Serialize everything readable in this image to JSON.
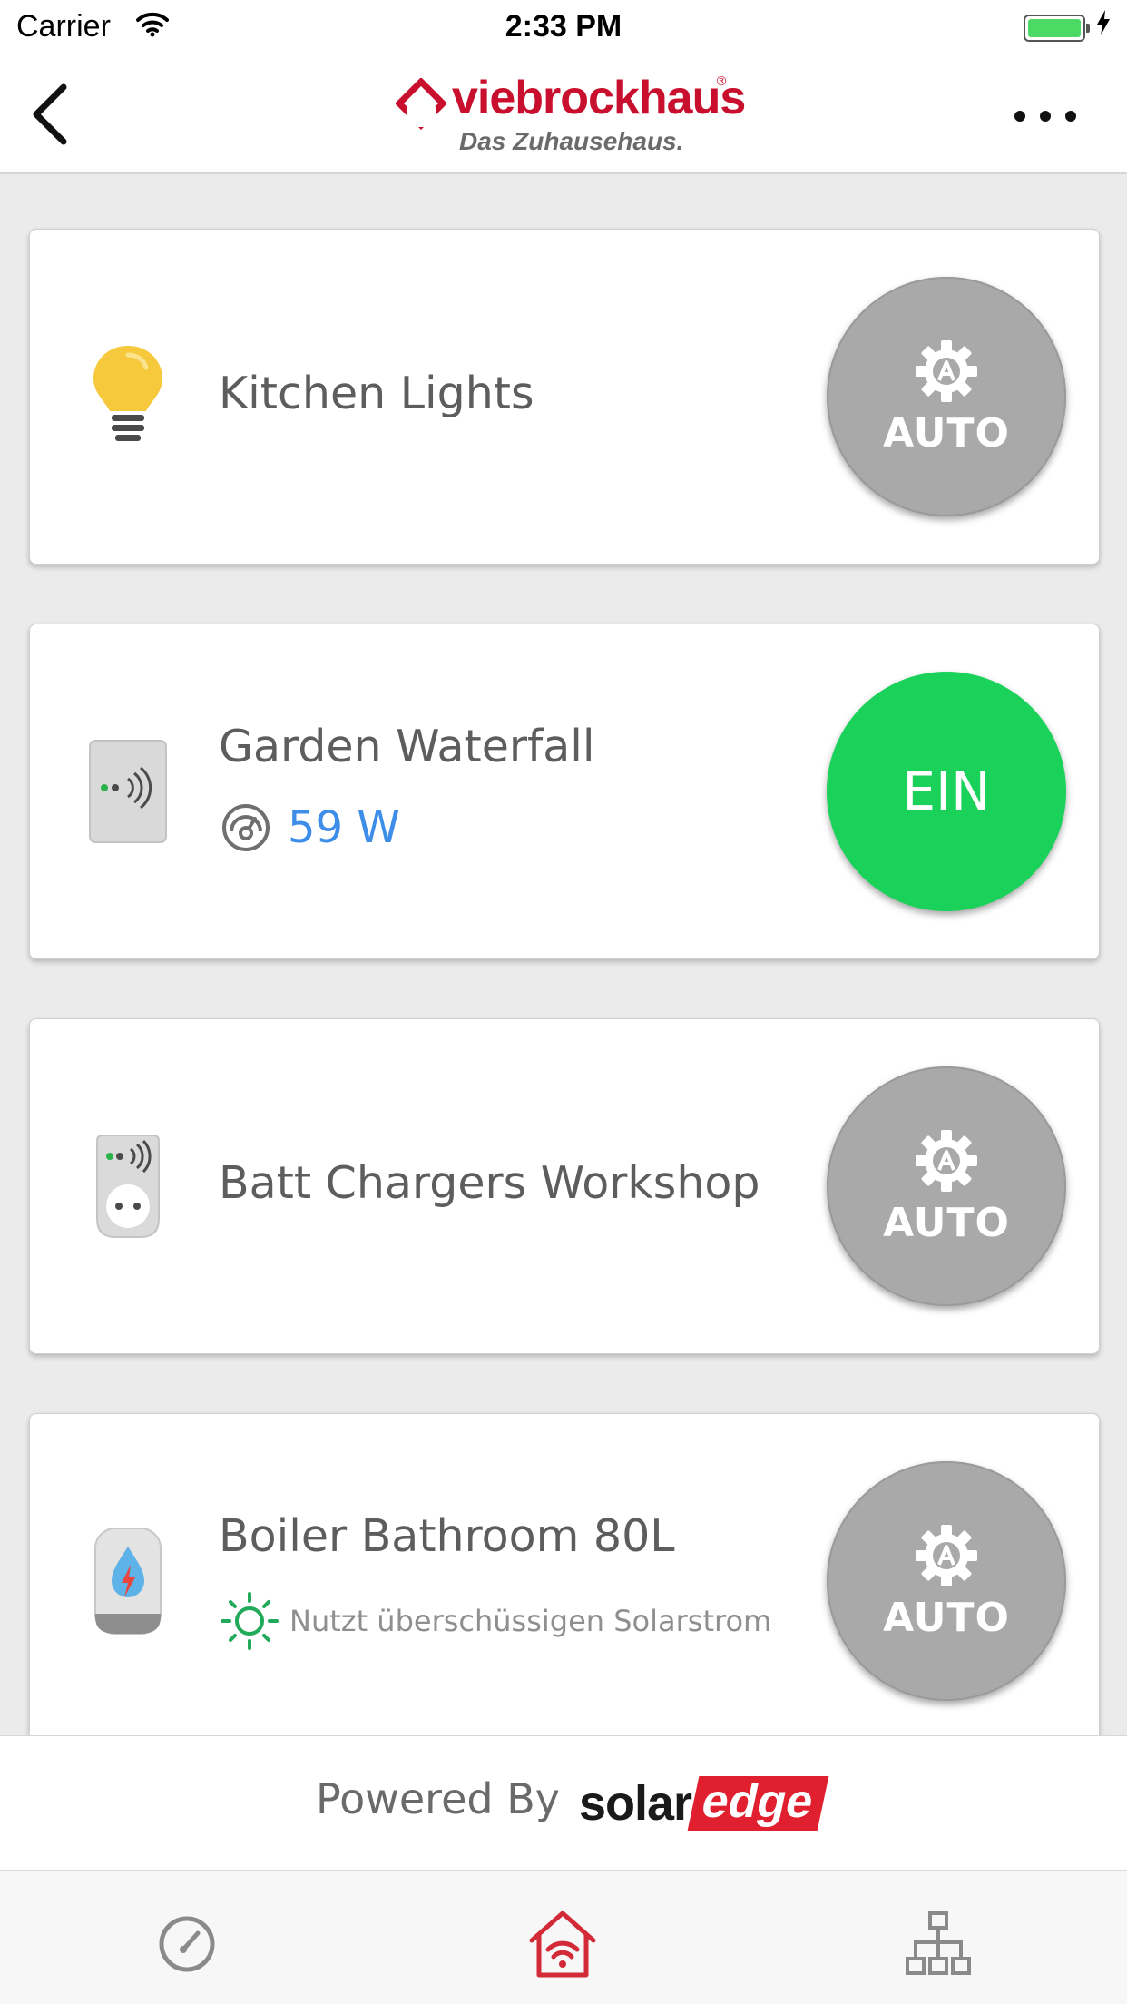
{
  "status_bar": {
    "carrier": "Carrier",
    "time": "2:33 PM",
    "battery_color": "#4cd964"
  },
  "nav": {
    "back_icon": "chevron-left-icon",
    "more_icon": "more-dots-icon",
    "logo": {
      "name": "viebrockhaus",
      "registered": "®",
      "tagline": "Das Zuhausehaus.",
      "brand_color": "#c8102e"
    }
  },
  "devices": [
    {
      "name": "Kitchen Lights",
      "icon": "lightbulb-icon",
      "mode": "AUTO",
      "mode_icon": "auto-gear-icon"
    },
    {
      "name": "Garden Waterfall",
      "icon": "smart-relay-icon",
      "power_icon": "power-meter-icon",
      "power": "59 W",
      "mode": "EIN",
      "mode_color": "#1ad25a"
    },
    {
      "name": "Batt Chargers Workshop",
      "icon": "smart-plug-icon",
      "mode": "AUTO",
      "mode_icon": "auto-gear-icon"
    },
    {
      "name": "Boiler Bathroom 80L",
      "icon": "water-heater-icon",
      "status_icon": "sun-icon",
      "status": "Nutzt überschüssigen Solarstrom",
      "mode": "AUTO",
      "mode_icon": "auto-gear-icon"
    }
  ],
  "footer": {
    "powered_by": "Powered By",
    "brand_solar": "solar",
    "brand_edge": "edge",
    "brand_color": "#e0202e"
  },
  "tabs": [
    {
      "icon": "dashboard-gauge-icon",
      "active": false
    },
    {
      "icon": "smart-home-icon",
      "active": true,
      "color": "#d22a36"
    },
    {
      "icon": "network-layout-icon",
      "active": false
    }
  ]
}
